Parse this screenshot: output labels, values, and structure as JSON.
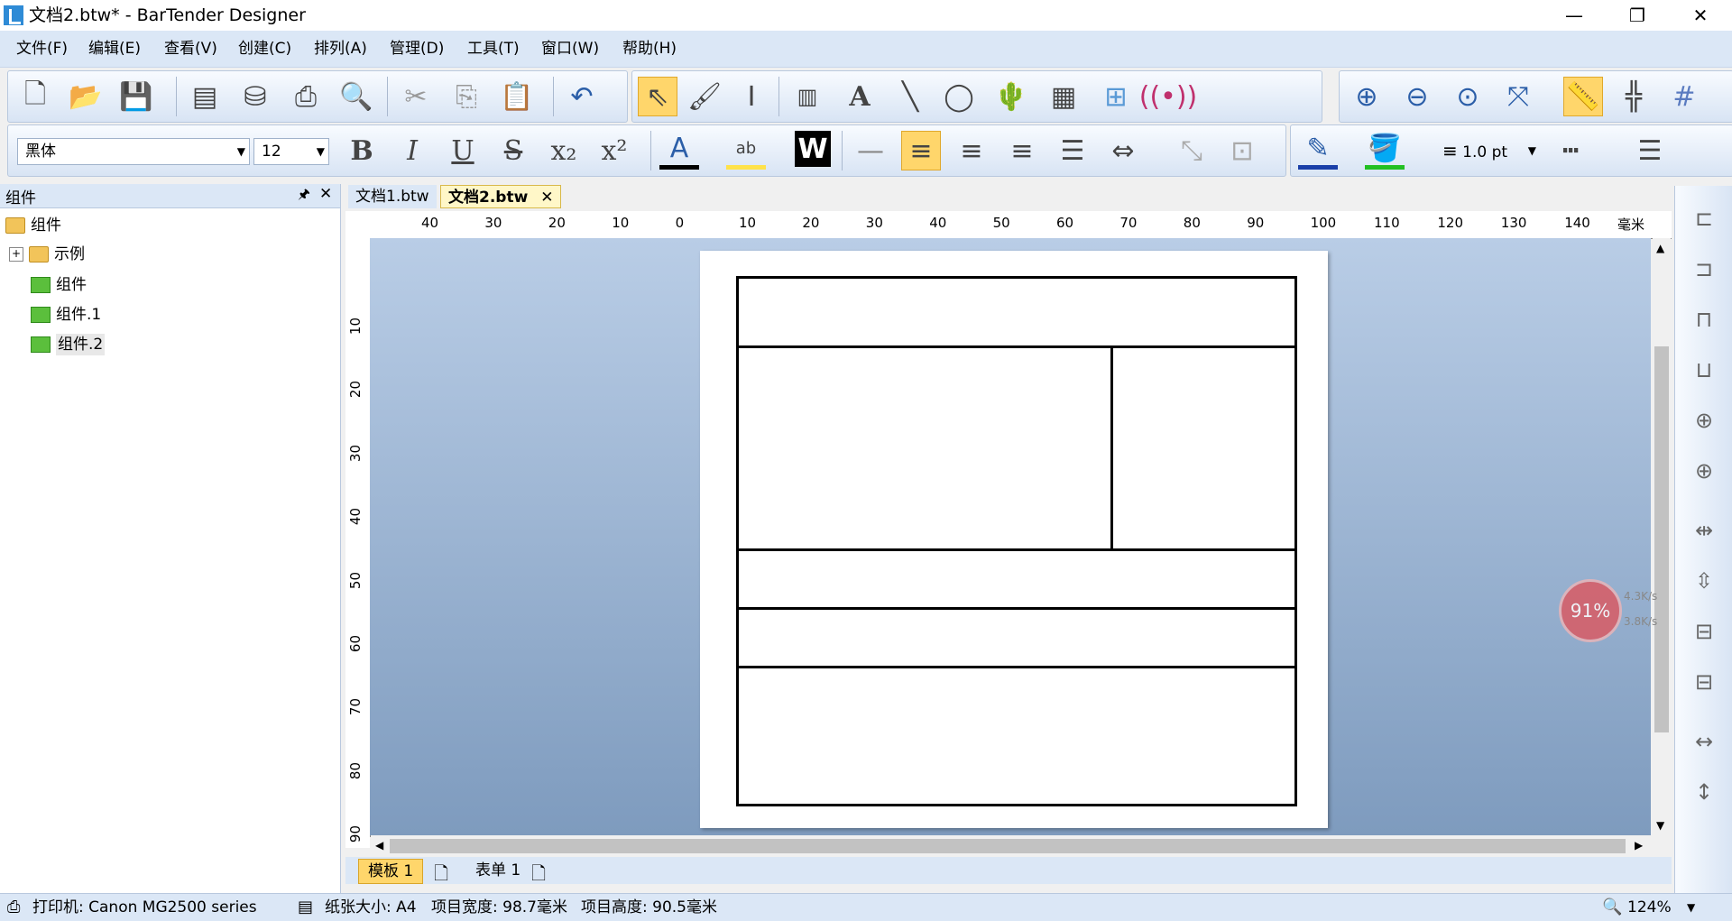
{
  "window": {
    "title": "文档2.btw* - BarTender Designer",
    "minimize": "—",
    "restore": "❐",
    "close": "✕"
  },
  "menu": [
    {
      "label": "文件(F)"
    },
    {
      "label": "编辑(E)"
    },
    {
      "label": "查看(V)"
    },
    {
      "label": "创建(C)"
    },
    {
      "label": "排列(A)"
    },
    {
      "label": "管理(D)"
    },
    {
      "label": "工具(T)"
    },
    {
      "label": "窗口(W)"
    },
    {
      "label": "帮助(H)"
    }
  ],
  "format": {
    "font": "黑体",
    "size": "12",
    "line_width": "1.0 pt"
  },
  "panel": {
    "title": "组件",
    "pin": "🖈",
    "close": "✕",
    "root": "组件",
    "items": [
      {
        "label": "示例",
        "expander": "+"
      },
      {
        "label": "组件"
      },
      {
        "label": "组件.1"
      },
      {
        "label": "组件.2"
      }
    ]
  },
  "tabs": [
    {
      "label": "文档1.btw"
    },
    {
      "label": "文档2.btw",
      "close": "✕"
    }
  ],
  "ruler": {
    "unit": "毫米",
    "top": [
      "40",
      "30",
      "20",
      "10",
      "0",
      "10",
      "20",
      "30",
      "40",
      "50",
      "60",
      "70",
      "80",
      "90",
      "100",
      "110",
      "120",
      "130",
      "140"
    ],
    "left": [
      "10",
      "20",
      "30",
      "40",
      "50",
      "60",
      "70",
      "80",
      "90"
    ]
  },
  "bottom_tabs": [
    {
      "label": "模板 1"
    },
    {
      "label": "表单 1"
    }
  ],
  "status": {
    "printer": "打印机: Canon MG2500 series",
    "paper": "纸张大小: A4",
    "item_width": "项目宽度: 98.7毫米",
    "item_height": "项目高度: 90.5毫米",
    "zoom": "124%"
  },
  "widget": {
    "cpu": "91%",
    "up": "4.3K/s",
    "down": "3.8K/s"
  }
}
